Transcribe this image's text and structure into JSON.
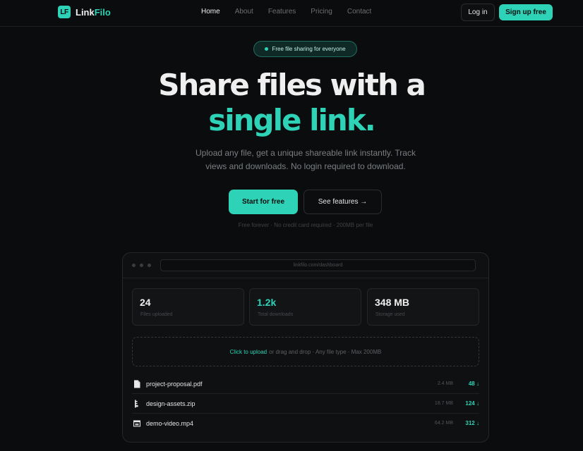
{
  "nav": {
    "logo_mark": "LF",
    "logo_name_a": "Link",
    "logo_name_b": "Filo",
    "links": [
      "Home",
      "About",
      "Features",
      "Pricing",
      "Contact"
    ],
    "active": "Home",
    "login": "Log in",
    "signup": "Sign up free"
  },
  "hero": {
    "pill": "Free file sharing for everyone",
    "title_line1": "Share files with a",
    "title_line2": "single link.",
    "subtitle": "Upload any file, get a unique shareable link instantly. Track views and downloads. No login required to download.",
    "cta_primary": "Start for free",
    "cta_secondary": "See features →",
    "note": "Free forever · No credit card required · 200MB per file"
  },
  "dashboard": {
    "url": "linkfilo.com/dashboard",
    "stats": [
      {
        "value": "24",
        "label": "Files uploaded"
      },
      {
        "value": "1.2k",
        "label": "Total downloads"
      },
      {
        "value": "348 MB",
        "label": "Storage used"
      }
    ],
    "upload": {
      "link": "Click to upload",
      "rest": "or drag and drop · Any file type · Max 200MB"
    },
    "files": [
      {
        "name": "project-proposal.pdf",
        "size": "2.4 MB",
        "downloads": "48",
        "icon": "document-icon"
      },
      {
        "name": "design-assets.zip",
        "size": "18.7 MB",
        "downloads": "124",
        "icon": "zip-icon"
      },
      {
        "name": "demo-video.mp4",
        "size": "64.2 MB",
        "downloads": "312",
        "icon": "video-icon"
      }
    ]
  },
  "colors": {
    "accent": "#2ed3b7",
    "background": "#0b0c0d"
  }
}
